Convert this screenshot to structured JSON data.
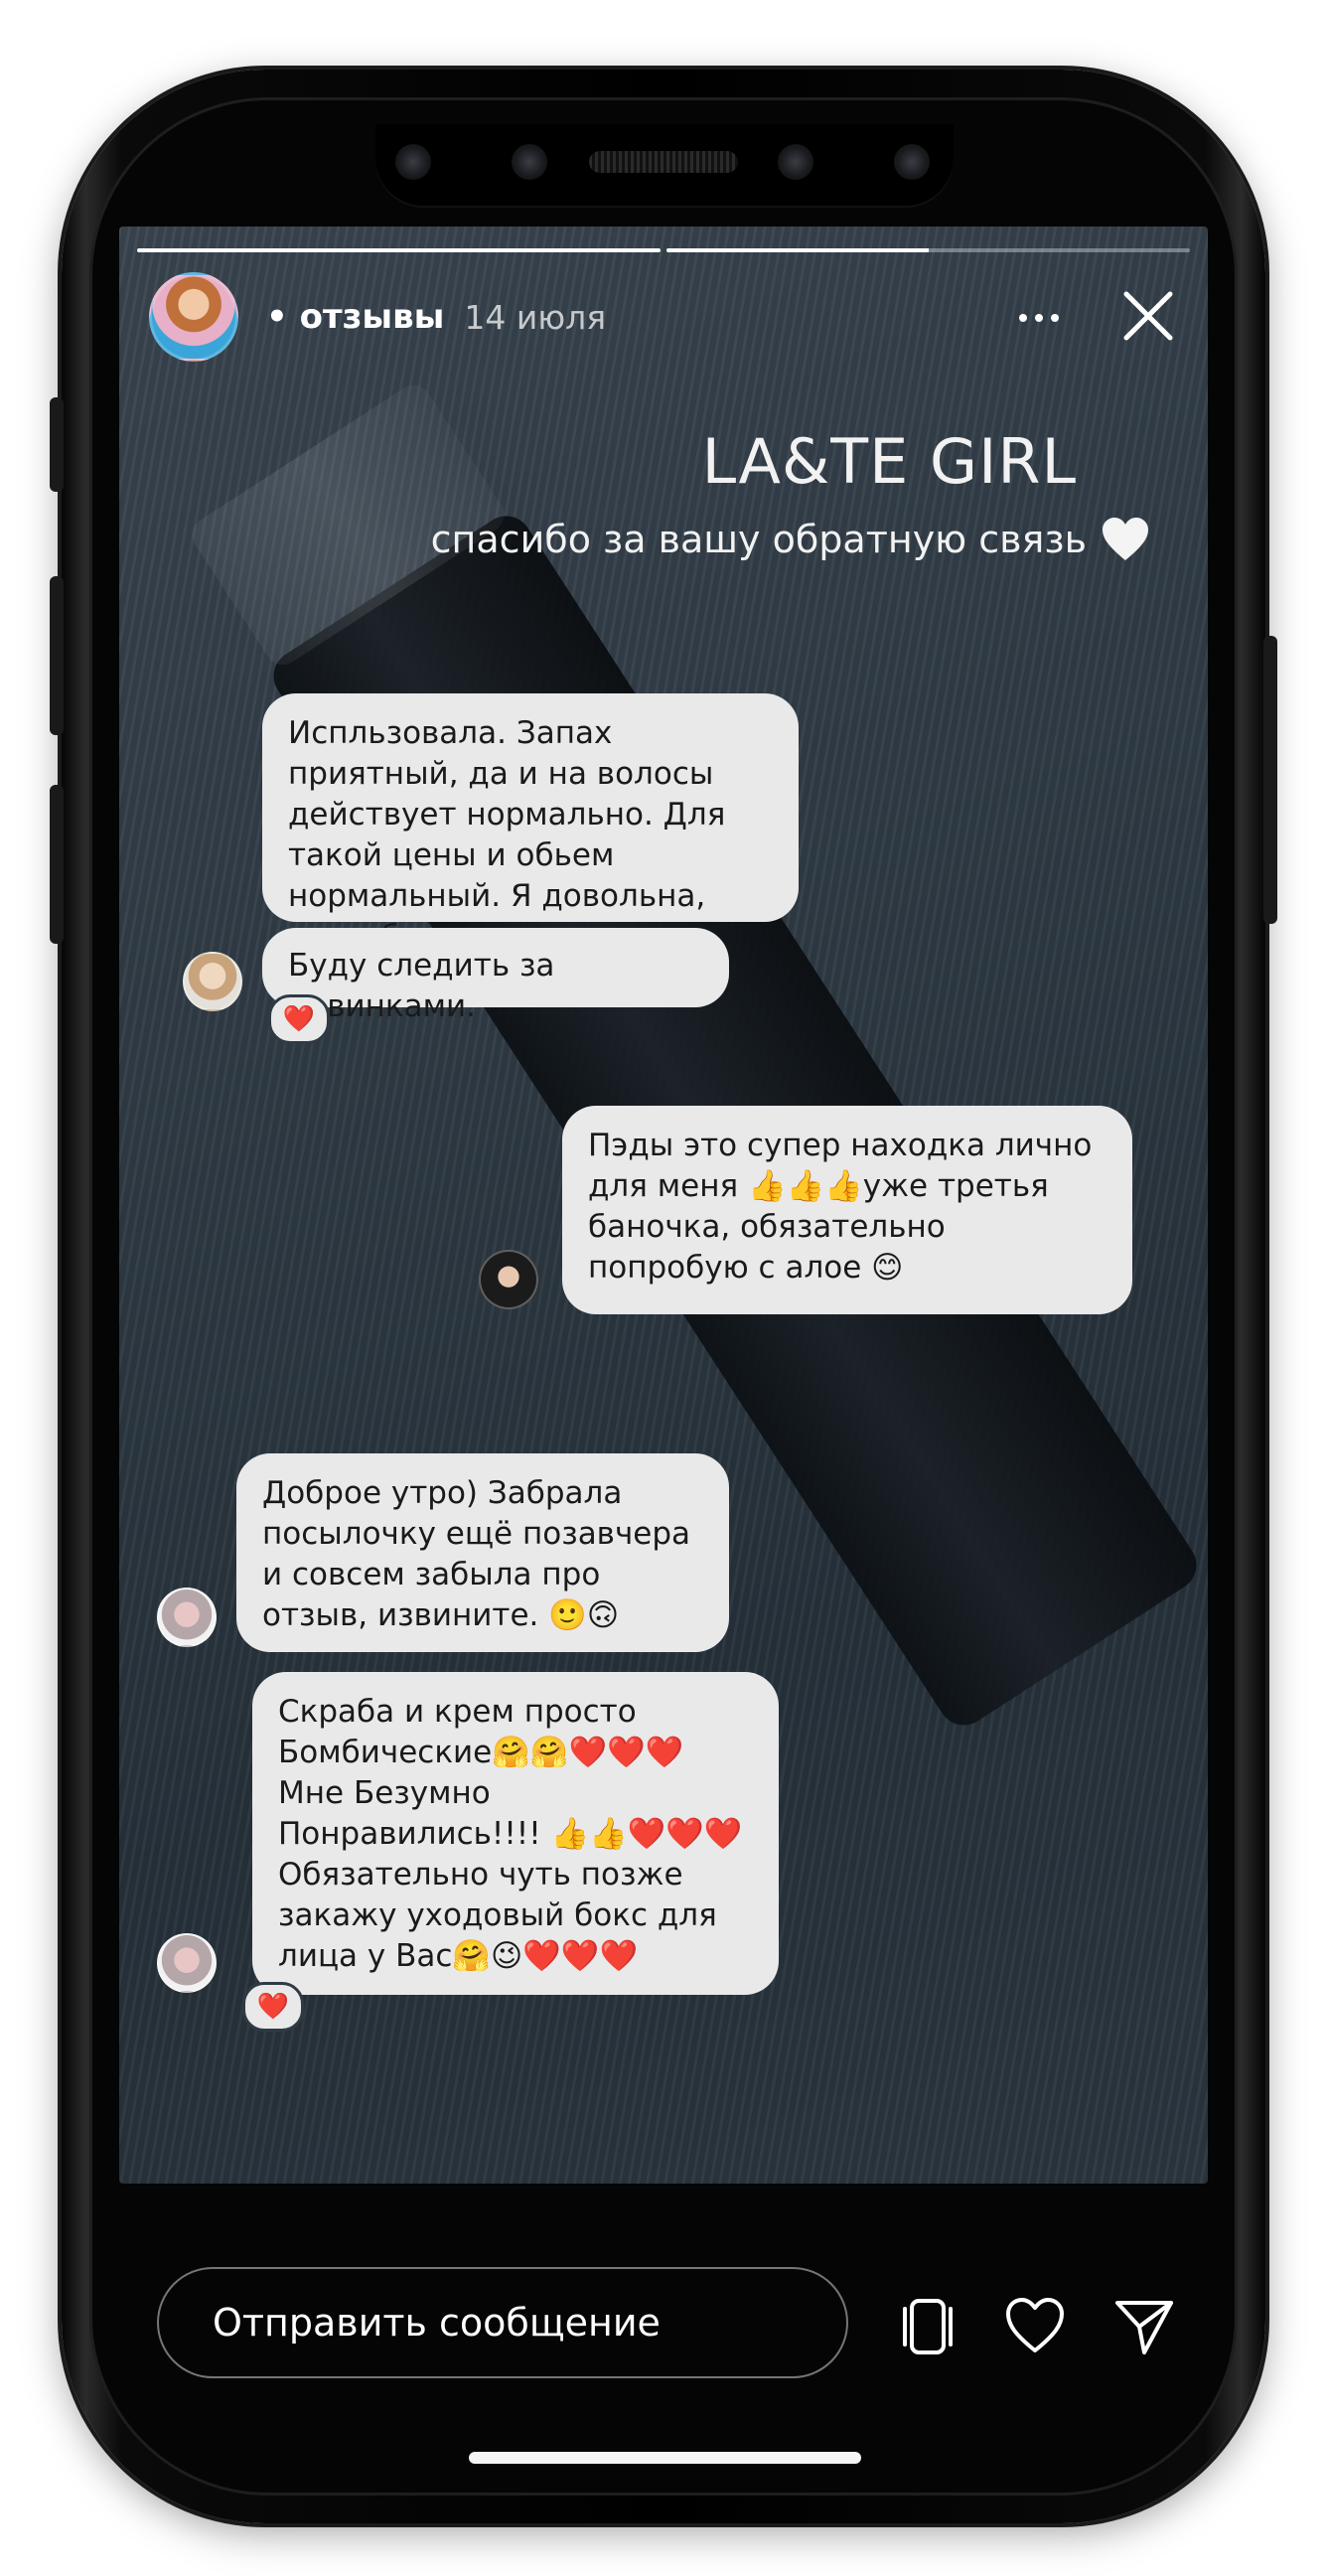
{
  "story": {
    "username": "• отзывы",
    "date": "14 июля",
    "progress": [
      1,
      0.5
    ]
  },
  "content": {
    "title": "LA&TE GIRL",
    "subtitle": "спасибо за вашу обратную связь",
    "subtitle_icon": "white-heart-icon"
  },
  "messages": [
    {
      "text": "Испльзовала. Запах приятный, да и на волосы действует нормально. Для такой цены и обьем нормальный. Я довольна, спасибо."
    },
    {
      "text": "Буду следить за новинками.",
      "reaction": "❤️"
    },
    {
      "text": "Пэды это супер находка лично для меня 👍👍👍уже третья баночка, обязательно попробую с алое 😊"
    },
    {
      "text": "Доброе утро) Забрала посылочку ещё позавчера и совсем забыла про отзыв, извините. 🙂🙃"
    },
    {
      "text": "Скраба и крем просто Бомбические🤗🤗❤️❤️❤️ Мне Безумно Понравились!!!! 👍👍❤️❤️❤️ Обязательно чуть позже закажу уходовый бокс для лица у Вас🤗😉❤️❤️❤️",
      "reaction": "❤️"
    }
  ],
  "bottom": {
    "message_placeholder": "Отправить сообщение",
    "icons": [
      "reels-icon",
      "heart-icon",
      "send-icon"
    ]
  },
  "colors": {
    "background": "#2f3a44",
    "bubble": "#e9e9ea",
    "text_light": "#ffffff",
    "reaction_heart": "#e0212c"
  }
}
